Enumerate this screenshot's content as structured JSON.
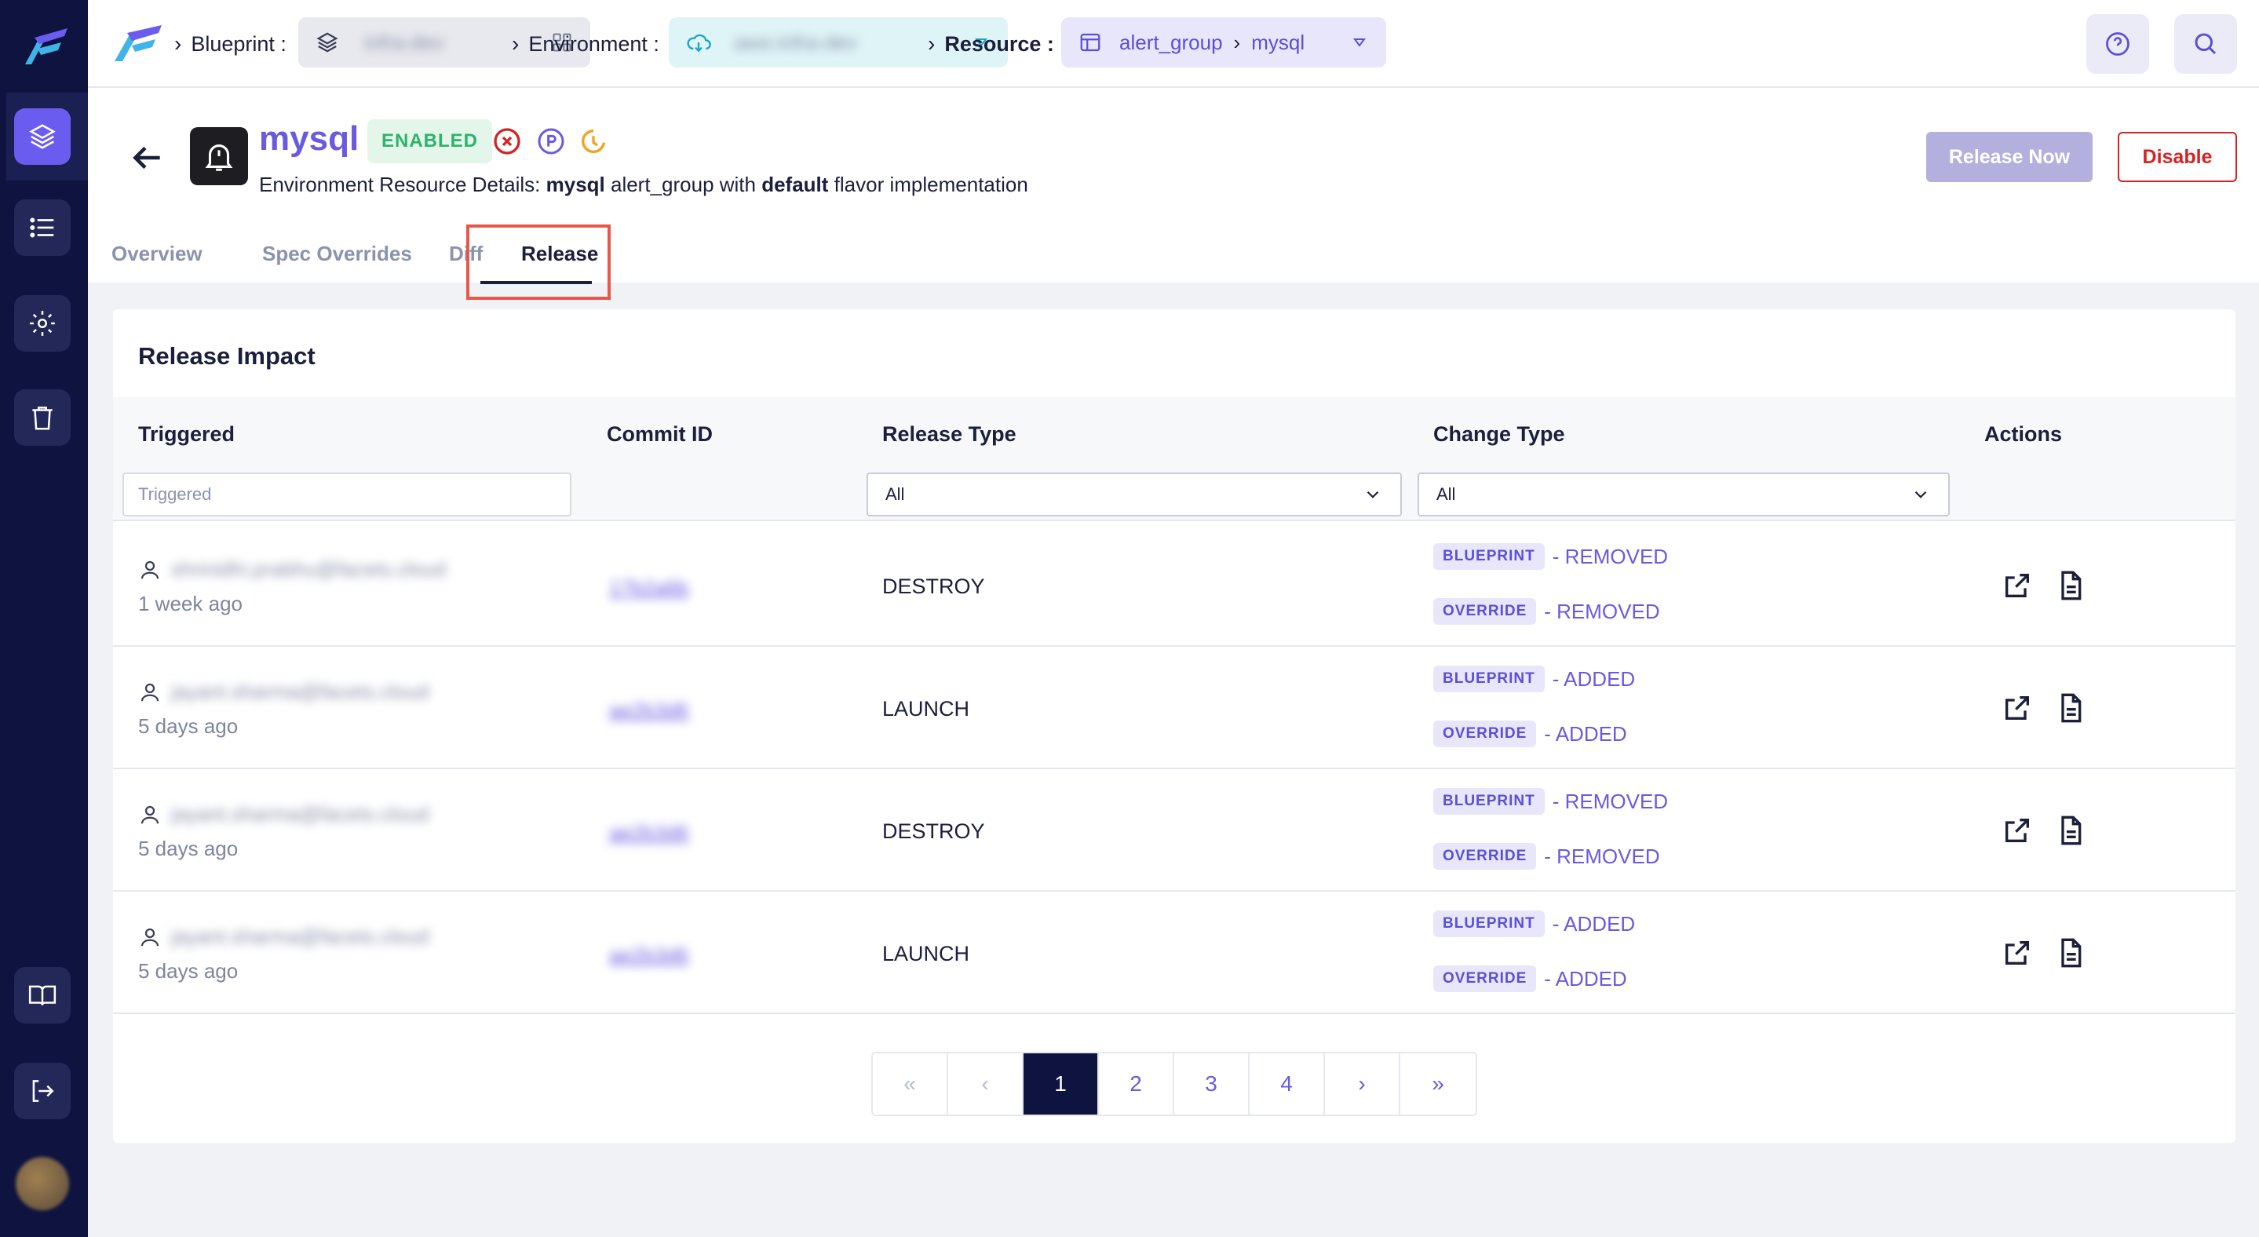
{
  "breadcrumb": {
    "blueprint_label": "Blueprint :",
    "blueprint_value": "infra-dev",
    "environment_label": "Environment :",
    "environment_value": "aws-infra-dev",
    "resource_label": "Resource :",
    "resource_type": "alert_group",
    "resource_name": "mysql"
  },
  "resource": {
    "name": "mysql",
    "status": "ENABLED",
    "subtitle_prefix": "Environment Resource Details: ",
    "subtitle_name": "mysql",
    "subtitle_mid": " alert_group with ",
    "subtitle_flavor": "default",
    "subtitle_suffix": " flavor implementation"
  },
  "buttons": {
    "release_now": "Release Now",
    "disable": "Disable"
  },
  "tabs": [
    {
      "label": "Overview"
    },
    {
      "label": "Spec Overrides"
    },
    {
      "label": "Diff"
    },
    {
      "label": "Release"
    }
  ],
  "active_tab": "Release",
  "card": {
    "title": "Release Impact",
    "columns": [
      "Triggered",
      "Commit ID",
      "Release Type",
      "Change Type",
      "Actions"
    ],
    "filters": {
      "triggered_placeholder": "Triggered",
      "release_type": "All",
      "change_type": "All"
    },
    "rows": [
      {
        "user": "shrinidhi.prabhu@facets.cloud",
        "ago": "1 week ago",
        "commit": "17b2a6b",
        "release_type": "DESTROY",
        "changes": [
          {
            "chip": "BLUEPRINT",
            "text": "- REMOVED"
          },
          {
            "chip": "OVERRIDE",
            "text": "- REMOVED"
          }
        ]
      },
      {
        "user": "jayant.sharma@facets.cloud",
        "ago": "5 days ago",
        "commit": "ae2b3d6",
        "release_type": "LAUNCH",
        "changes": [
          {
            "chip": "BLUEPRINT",
            "text": "- ADDED"
          },
          {
            "chip": "OVERRIDE",
            "text": "- ADDED"
          }
        ]
      },
      {
        "user": "jayant.sharma@facets.cloud",
        "ago": "5 days ago",
        "commit": "ae2b3d6",
        "release_type": "DESTROY",
        "changes": [
          {
            "chip": "BLUEPRINT",
            "text": "- REMOVED"
          },
          {
            "chip": "OVERRIDE",
            "text": "- REMOVED"
          }
        ]
      },
      {
        "user": "jayant.sharma@facets.cloud",
        "ago": "5 days ago",
        "commit": "ae2b3d6",
        "release_type": "LAUNCH",
        "changes": [
          {
            "chip": "BLUEPRINT",
            "text": "- ADDED"
          },
          {
            "chip": "OVERRIDE",
            "text": "- ADDED"
          }
        ]
      }
    ]
  },
  "pagination": {
    "first": "«",
    "prev": "‹",
    "pages": [
      "1",
      "2",
      "3",
      "4"
    ],
    "next": "›",
    "last": "»",
    "current": "1"
  },
  "colors": {
    "sidebar": "#0f1340",
    "accent": "#6a5ae0",
    "danger": "#d32424",
    "enabled": "#2db36a"
  },
  "icons": [
    "layers-icon",
    "list-icon",
    "gear-icon",
    "trash-icon",
    "book-icon",
    "logout-icon",
    "help-icon",
    "search-icon",
    "back-arrow-icon",
    "bell-alert-icon",
    "error-circle-icon",
    "p-badge-icon",
    "schedule-icon",
    "external-link-icon",
    "document-icon",
    "user-icon"
  ]
}
